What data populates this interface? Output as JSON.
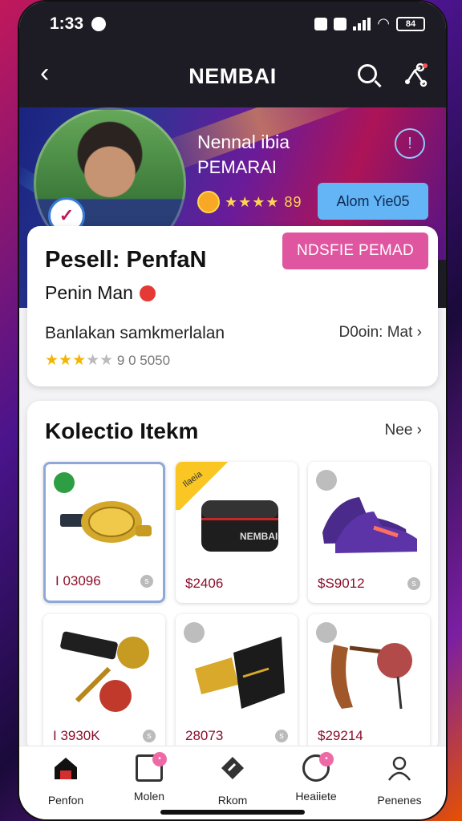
{
  "status": {
    "time": "1:33",
    "battery": "84"
  },
  "nav": {
    "title": "NEMBAI"
  },
  "hero": {
    "name": "Nennal ibia",
    "subtitle": "PEMARAI",
    "rating": "★★★★ 89",
    "follow_label": "Alom Yie05",
    "info_glyph": "!"
  },
  "profile": {
    "message_label": "NDSFIE PEMAD",
    "name": "Pesell: PenfaN",
    "role": "Penin Man",
    "description": "Banlakan samkmerlalan",
    "more_label": "D0oin: Mat",
    "rating_count": "9 0 5050"
  },
  "collection": {
    "title": "Kolectio Itekm",
    "see_all": "Nee",
    "items": [
      {
        "name": "gold-watch",
        "price": "I 03096 "
      },
      {
        "name": "black-case",
        "price": "$2406",
        "ribbon": "Ilaeia",
        "case_label": "NEMBAI"
      },
      {
        "name": "purple-sneakers",
        "price": "$S9012"
      },
      {
        "name": "keychain-medal",
        "price": "I 3930K"
      },
      {
        "name": "gold-glove",
        "price": "28073"
      },
      {
        "name": "leather-sling",
        "price": "$29214"
      }
    ]
  },
  "tabs": [
    {
      "label": "Penfon"
    },
    {
      "label": "Molen"
    },
    {
      "label": "Rkom"
    },
    {
      "label": "Heaiiete"
    },
    {
      "label": "Penenes"
    }
  ],
  "colors": {
    "accent": "#e0559f",
    "follow": "#64b5f6",
    "price": "#8b0e2a"
  }
}
